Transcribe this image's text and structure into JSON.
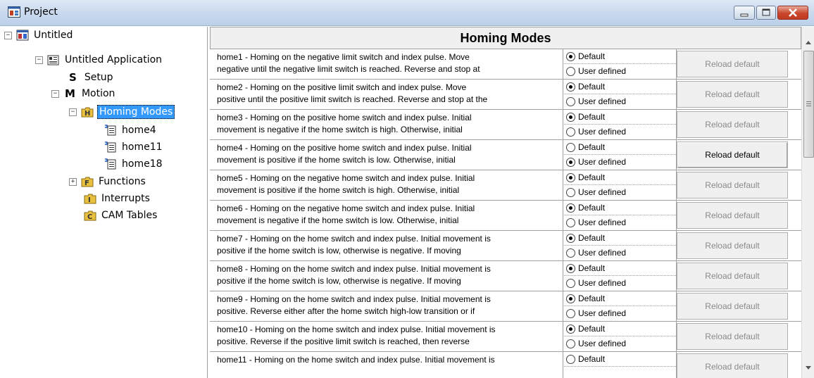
{
  "window": {
    "title": "Project"
  },
  "tree": {
    "root": "Untitled",
    "application": "Untitled Application",
    "setup": "Setup",
    "motion": "Motion",
    "homing_modes": "Homing Modes",
    "home_items": [
      "home4",
      "home11",
      "home18"
    ],
    "functions": "Functions",
    "interrupts": "Interrupts",
    "cam_tables": "CAM Tables"
  },
  "grid": {
    "header": "Homing Modes",
    "option_default": "Default",
    "option_user": "User defined",
    "button_label": "Reload default",
    "rows": [
      {
        "line1": "home1 - Homing on the negative limit switch and index pulse. Move",
        "line2": "negative until the negative limit switch is reached. Reverse and stop at",
        "selected": "default",
        "button_enabled": false
      },
      {
        "line1": "home2 - Homing on the positive limit switch and index pulse. Move",
        "line2": "positive until the positive limit switch is reached. Reverse and stop at the",
        "selected": "default",
        "button_enabled": false
      },
      {
        "line1": "home3 - Homing on the positive home switch and index pulse. Initial",
        "line2": "movement is negative if the home switch is high. Otherwise, initial",
        "selected": "default",
        "button_enabled": false
      },
      {
        "line1": "home4 - Homing on the positive home switch and index pulse. Initial",
        "line2": "movement is positive if the home switch is low. Otherwise, initial",
        "selected": "user",
        "button_enabled": true
      },
      {
        "line1": "home5 - Homing on the negative home switch and index pulse. Initial",
        "line2": "movement is positive if the home switch is high. Otherwise, initial",
        "selected": "default",
        "button_enabled": false
      },
      {
        "line1": "home6 - Homing on the negative home switch and index pulse. Initial",
        "line2": "movement is negative if the home switch is low. Otherwise, initial",
        "selected": "default",
        "button_enabled": false
      },
      {
        "line1": "home7 - Homing on the home switch and index pulse. Initial movement is",
        "line2": "positive if the home switch is low, otherwise is negative. If moving",
        "selected": "default",
        "button_enabled": false
      },
      {
        "line1": "home8 - Homing on the home switch and index pulse. Initial movement is",
        "line2": "positive if the home switch is low, otherwise is negative. If moving",
        "selected": "default",
        "button_enabled": false
      },
      {
        "line1": "home9 - Homing on the home switch and index pulse. Initial movement is",
        "line2": "positive. Reverse either after the home switch high-low transition or if",
        "selected": "default",
        "button_enabled": false
      },
      {
        "line1": "home10 - Homing on the home switch and index pulse. Initial movement is",
        "line2": "positive. Reverse if the positive limit switch is reached, then reverse",
        "selected": "default",
        "button_enabled": false
      },
      {
        "line1": "home11 - Homing on the home switch and index pulse. Initial movement is",
        "line2": "",
        "selected": "none",
        "button_enabled": false
      }
    ]
  }
}
